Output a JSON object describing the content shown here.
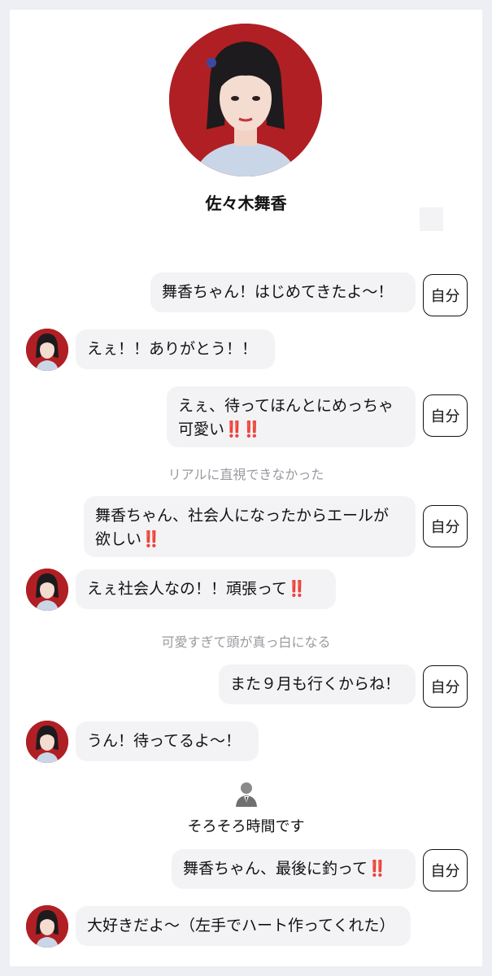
{
  "profile": {
    "name": "佐々木舞香"
  },
  "self_tag": "自分",
  "messages": {
    "m1": "舞香ちゃん！はじめてきたよ〜！",
    "m2": "えぇ！！ありがとう！！",
    "m3_line1": "えぇ、待ってほんとにめっちゃ",
    "m3_line2": "可愛い",
    "m3_suffix": "‼️‼️",
    "note1": "リアルに直視できなかった",
    "m4_line1": "舞香ちゃん、社会人になったからエールが",
    "m4_line2": "欲しい",
    "m4_suffix": "‼️",
    "m5": "えぇ社会人なの！！頑張って",
    "m5_suffix": "‼️",
    "note2": "可愛すぎて頭が真っ白になる",
    "m6": "また９月も行くからね！",
    "m7": "うん！待ってるよ〜！",
    "system": "そろそろ時間です",
    "m8": "舞香ちゃん、最後に釣って",
    "m8_suffix": "‼️",
    "m9": "大好きだよ〜（左手でハート作ってくれた）"
  },
  "colors": {
    "accent_red": "#b01f24",
    "bubble_bg": "#f3f3f5",
    "note_gray": "#999aa0"
  },
  "icons": {
    "system": "person-in-suit-icon"
  }
}
